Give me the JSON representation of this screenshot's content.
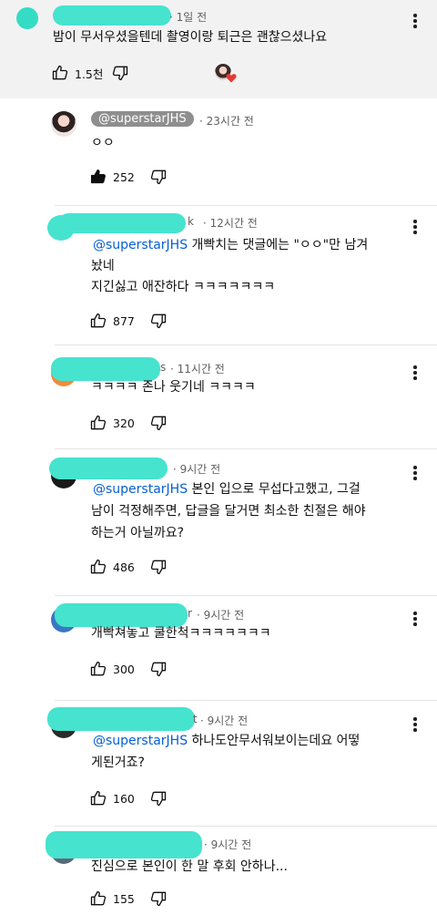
{
  "colors": {
    "redaction": "#46e3cf",
    "mention": "#065fd4",
    "heart": "#e53935"
  },
  "top_comment": {
    "time": "· 1일 전",
    "text": "밤이 무서우셨을텐데 촬영이랑 퇴근은 괜찮으셨나요",
    "likes": "1.5천"
  },
  "replies": [
    {
      "handle": "@superstarJHS",
      "time": "· 23시간 전",
      "line1": "ㅇㅇ",
      "likes": "252"
    },
    {
      "handle_tail": "k",
      "time": "· 12시간 전",
      "mention": "@superstarJHS",
      "line1": " 개빡치는 댓글에는 \"ㅇㅇ\"만 남겨",
      "line2": "놨네",
      "line3": "지긴싫고 애잔하다 ㅋㅋㅋㅋㅋㅋㅋ",
      "likes": "877"
    },
    {
      "handle_tail": "s",
      "time": "· 11시간 전",
      "line1": "ㅋㅋㅋㅋ 존나 웃기네 ㅋㅋㅋㅋ",
      "likes": "320"
    },
    {
      "time": "· 9시간 전",
      "mention": "@superstarJHS",
      "line1": " 본인 입으로 무섭다고했고, 그걸",
      "line2": "남이 걱정해주면, 답글을 달거면 최소한 친절은 해야",
      "line3": "하는거 아닐까요?",
      "likes": "486"
    },
    {
      "handle_tail": "r",
      "time": "· 9시간 전",
      "line1": "개빡쳐놓고 쿨한척ㅋㅋㅋㅋㅋㅋㅋ",
      "likes": "300"
    },
    {
      "handle_tail": "t",
      "time": "· 9시간 전",
      "mention": "@superstarJHS",
      "line1": " 하나도안무서워보이는데요 어떻",
      "line2": "게된거죠?",
      "likes": "160"
    },
    {
      "time": "· 9시간 전",
      "line1": "진심으로 본인이 한 말 후회 안하나...",
      "likes": "155"
    }
  ]
}
